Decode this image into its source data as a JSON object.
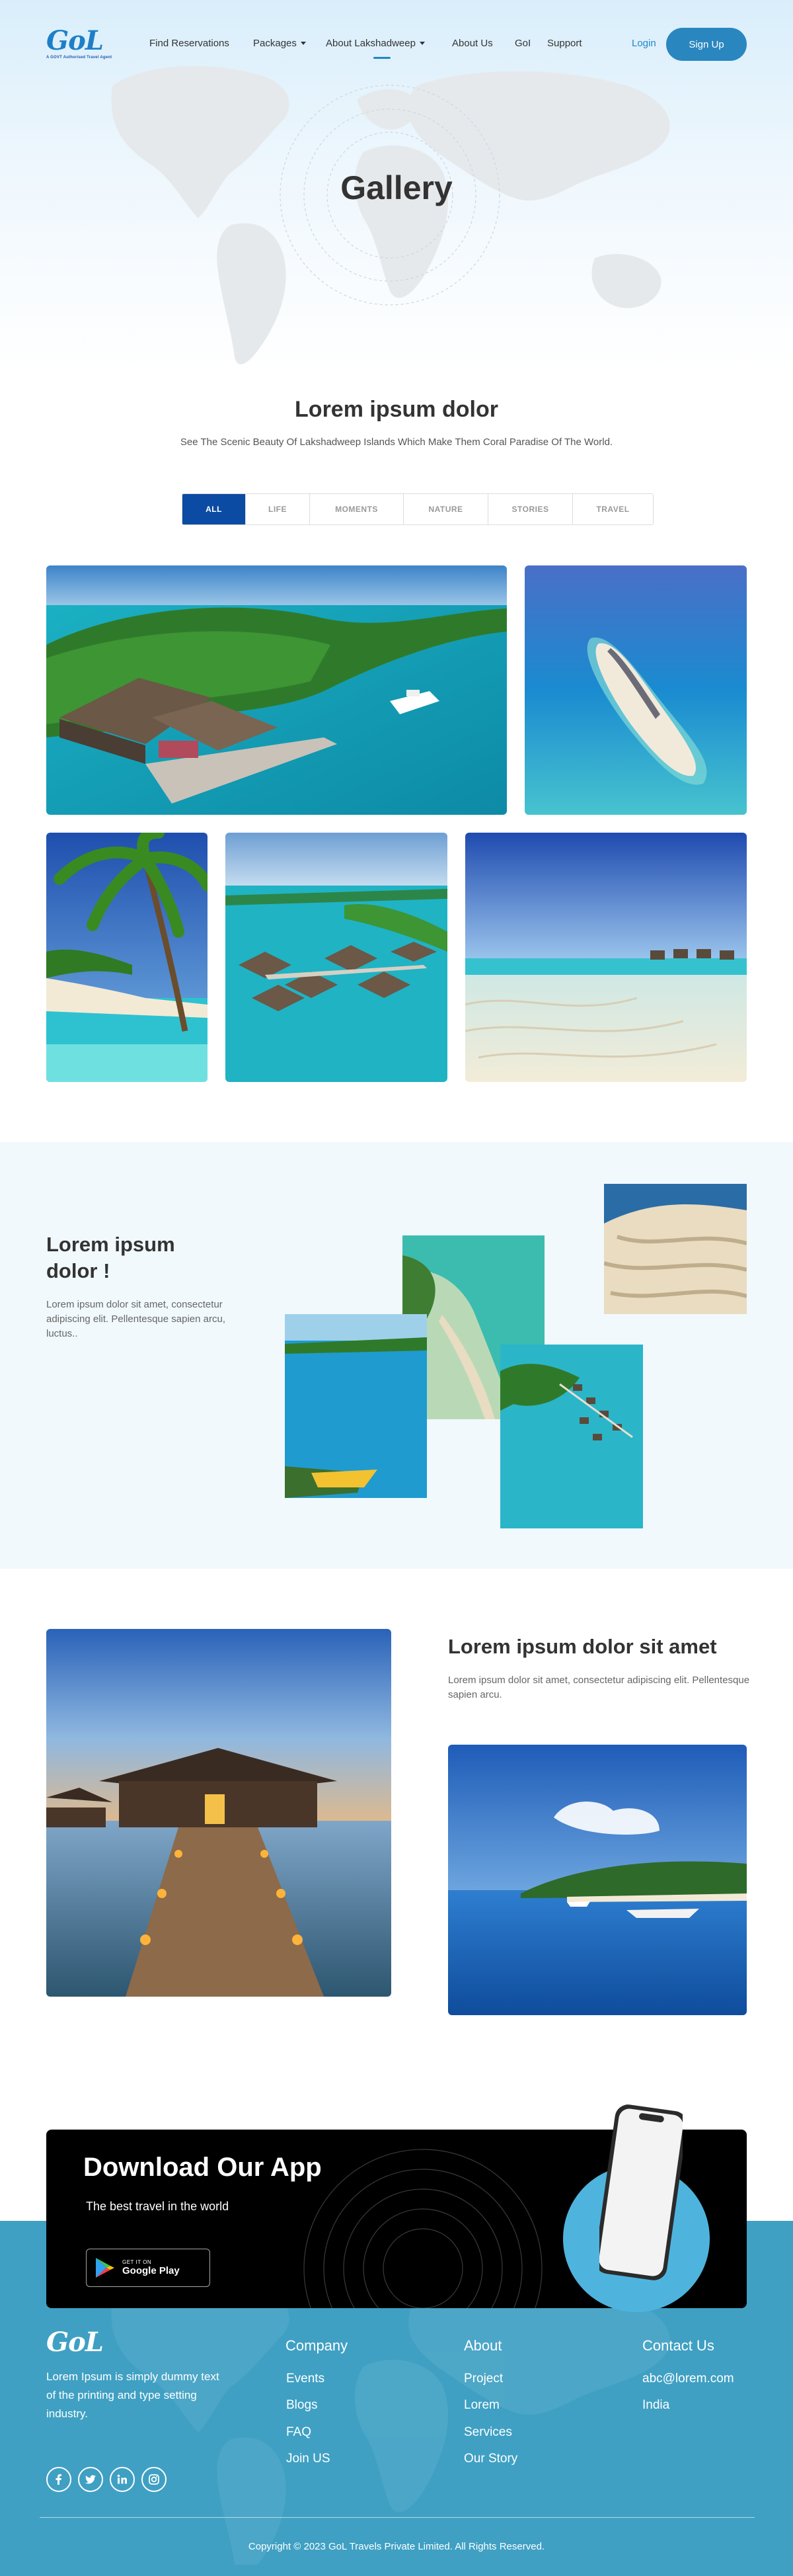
{
  "nav": {
    "logo_text": "GoL",
    "logo_tagline": "A GOVT Authorised Travel Agent",
    "links": [
      "Find Reservations",
      "Packages",
      "About Lakshadweep",
      "About Us",
      "GoI",
      "Support"
    ],
    "login": "Login",
    "signup": "Sign Up"
  },
  "hero": {
    "title": "Gallery"
  },
  "gallery": {
    "title": "Lorem ipsum dolor",
    "subtitle": "See The Scenic Beauty Of Lakshadweep Islands Which Make Them Coral Paradise Of The World.",
    "tabs": [
      "ALL",
      "LIFE",
      "MOMENTS",
      "NATURE",
      "STORIES",
      "TRAVEL"
    ],
    "active_tab": "ALL"
  },
  "band": {
    "title": "Lorem ipsum dolor !",
    "text": "Lorem ipsum dolor sit amet, consectetur adipiscing elit. Pellentesque sapien arcu, luctus.."
  },
  "feature": {
    "title": "Lorem ipsum dolor sit amet",
    "text": "Lorem ipsum dolor sit amet, consectetur adipiscing elit. Pellentesque sapien arcu."
  },
  "app": {
    "title": "Download Our App",
    "subtitle": "The best travel in the world",
    "store_small": "GET IT ON",
    "store_big": "Google Play"
  },
  "footer": {
    "logo_text": "GoL",
    "about": "Lorem Ipsum is simply dummy text of the printing and type setting industry.",
    "company": {
      "title": "Company",
      "links": [
        "Events",
        "Blogs",
        "FAQ",
        "Join US"
      ]
    },
    "about_col": {
      "title": "About",
      "links": [
        "Project",
        "Lorem",
        "Services",
        "Our Story"
      ]
    },
    "contact": {
      "title": "Contact Us",
      "email": "abc@lorem.com",
      "country": "India"
    },
    "copyright": "Copyright © 2023 GoL Travels Private Limited. All Rights Reserved."
  },
  "icons": [
    "facebook-icon",
    "twitter-icon",
    "linkedin-icon",
    "instagram-icon",
    "google-play-icon",
    "chevron-down-icon"
  ],
  "colors": {
    "primary": "#2a86bf",
    "active_tab": "#0c4ba3",
    "footer": "#3fa0c3",
    "band": "#f1f9fd"
  }
}
